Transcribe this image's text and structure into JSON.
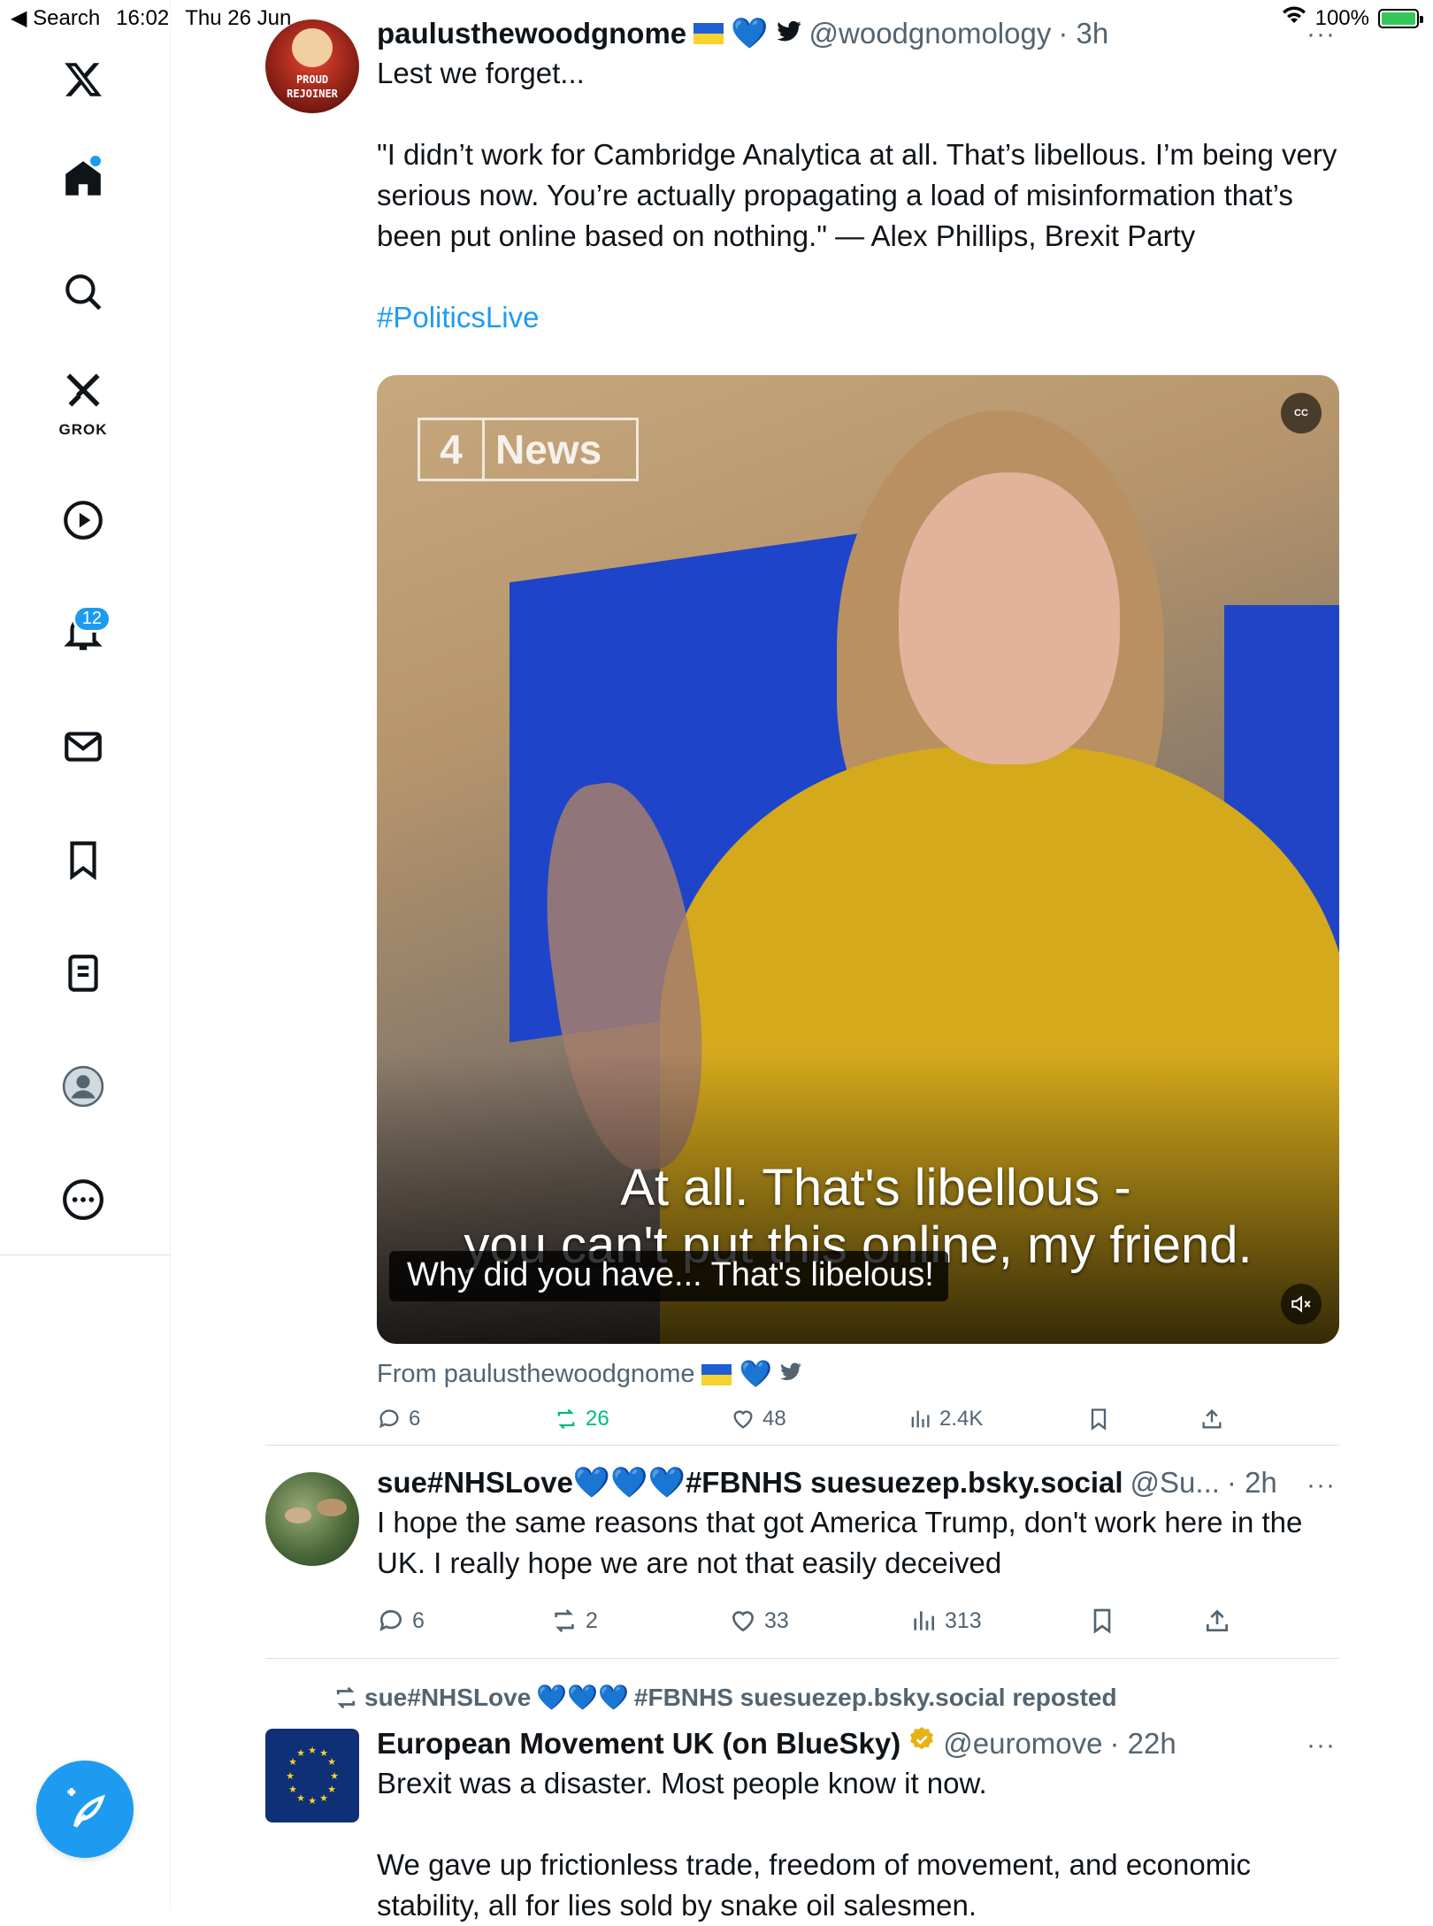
{
  "status_bar": {
    "back_label": "◀ Search",
    "time": "16:02",
    "date": "Thu 26 Jun",
    "battery": "100%",
    "battery_level": 1.0
  },
  "sidebar": {
    "grok_label": "GROK",
    "notifications_badge": "12"
  },
  "tweets": [
    {
      "name": "paulusthewoodgnome",
      "handle": "@woodgnomology",
      "time": "· 3h",
      "avatar_text_1": "PROUD",
      "avatar_text_2": "REJOINER",
      "body_1": "Lest we forget...",
      "body_2": "\"I didn’t work for Cambridge Analytica at all. That’s libellous. I’m being very serious now. You’re actually propagating a load of misinformation that’s been put online based on nothing.\" — Alex Phillips, Brexit Party",
      "hashtag": "#PoliticsLive",
      "media": {
        "logo_num": "4",
        "logo_text": "News",
        "cc_label": "CC",
        "burned_1": "At all. That's libellous -",
        "burned_2": "you can't put this online, my friend.",
        "caption": "Why did you have... That's libelous!"
      },
      "from": "From paulusthewoodgnome",
      "stats": {
        "replies": "6",
        "reposts": "26",
        "likes": "48",
        "views": "2.4K"
      }
    },
    {
      "name": "sue#NHSLove",
      "name_tail": "#FBNHS suesuezep.bsky.social",
      "handle": "@Su...",
      "time": "· 2h",
      "body": "I hope the same reasons that got America Trump, don't work here in the UK. I really hope we are not that easily deceived",
      "stats": {
        "replies": "6",
        "reposts": "2",
        "likes": "33",
        "views": "313"
      }
    },
    {
      "repost_by": "sue#NHSLove",
      "repost_tail": "#FBNHS suesuezep.bsky.social reposted",
      "name": "European Movement UK (on BlueSky)",
      "handle": "@euromove",
      "time": "· 22h",
      "body_1": "Brexit was a disaster. Most people know it now.",
      "body_2": "We gave up frictionless trade, freedom of movement, and economic stability, all for lies sold by snake oil salesmen."
    }
  ],
  "colors": {
    "accent": "#1d9bf0",
    "repost_green": "#00ba7c",
    "text_secondary": "#536471"
  }
}
